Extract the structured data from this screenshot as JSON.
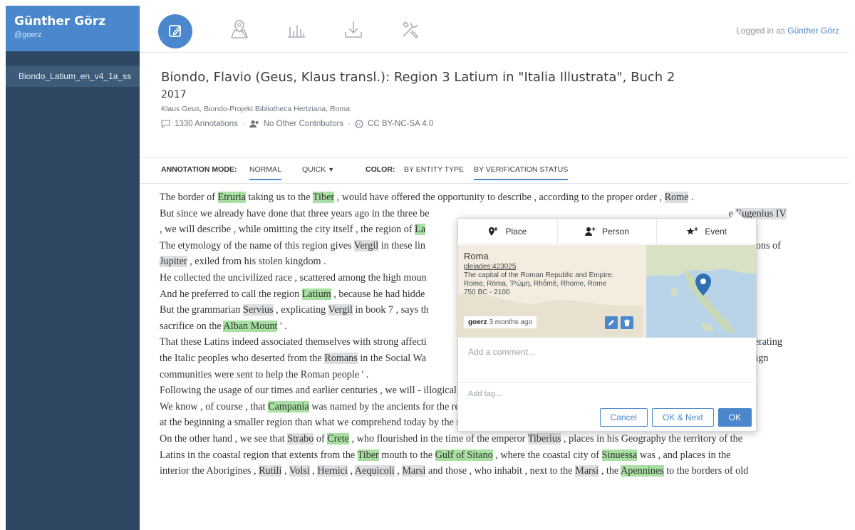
{
  "colors": {
    "accent": "#4a87cd",
    "sidebar": "#2d4763",
    "highlight_verified": "#a8e0a2",
    "highlight_unverified": "#dcdfe2"
  },
  "sidebar": {
    "user_name": "Günther Görz",
    "user_handle": "@goerz",
    "document": "Biondo_Latium_en_v4_1a_ss"
  },
  "topbar": {
    "icons": [
      "annotate-icon",
      "map-icon",
      "stats-icon",
      "download-icon",
      "settings-icon"
    ],
    "logged_in_label": "Logged in as",
    "logged_in_user": "Günther Görz"
  },
  "doc": {
    "title": "Biondo, Flavio (Geus, Klaus transl.): Region 3 Latium in \"Italia Illustrata\", Buch 2",
    "year": "2017",
    "author": "Klaus Geus, Biondo-Projekt Bibliotheca Hertziana, Roma",
    "annotations": "1330 Annotations",
    "contributors": "No Other Contributors",
    "license": "CC BY-NC-SA 4.0"
  },
  "modebar": {
    "mode_label": "ANNOTATION MODE:",
    "normal": "NORMAL",
    "quick": "QUICK",
    "color_label": "COLOR:",
    "by_entity": "BY ENTITY TYPE",
    "by_status": "BY VERIFICATION STATUS"
  },
  "popup": {
    "tabs": [
      "Place",
      "Person",
      "Event"
    ],
    "place_name": "Roma",
    "place_id": "pleiades:423025",
    "place_desc": "The capital of the Roman Republic and Empire.",
    "place_alt": "Rome, Rōma, ʽΡώμη, Rhṓmē, Rhome, Rome",
    "place_dates": "750 BC - 2100",
    "user": "goerz",
    "time": "3 months ago",
    "comment_placeholder": "Add a comment...",
    "tag_placeholder": "Add tag...",
    "cancel": "Cancel",
    "ok_next": "OK & Next",
    "ok": "OK"
  }
}
